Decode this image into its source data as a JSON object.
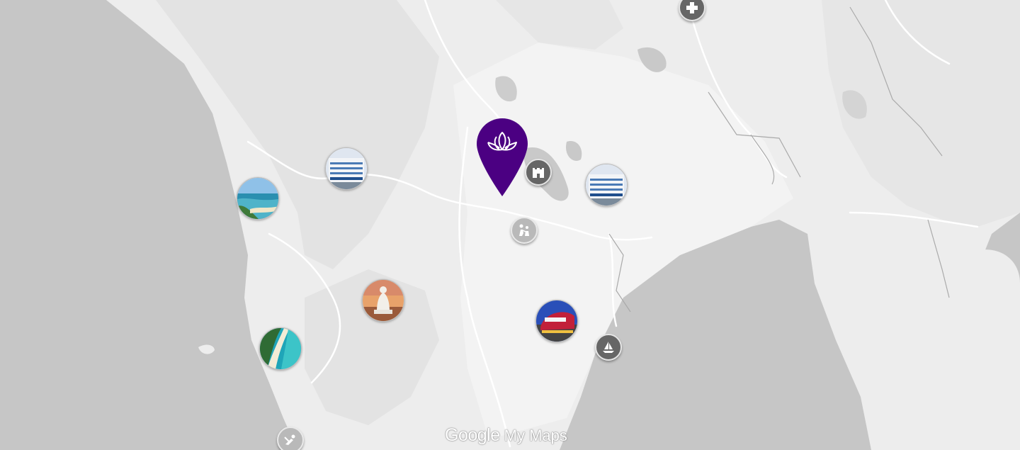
{
  "map": {
    "provider_logo": "Google",
    "product_label": "My Maps",
    "colors": {
      "water": "#c6c6c6",
      "land": "#ededed",
      "land_light": "#f3f3f3",
      "hills": "#e2e2e2",
      "roads": "#ffffff",
      "pin": "#4b0082",
      "poi_dark": "#666666",
      "poi_light": "#b9b9b9"
    },
    "markers": [
      {
        "id": "main-pin",
        "type": "pin",
        "icon": "lotus-icon"
      },
      {
        "id": "school-west",
        "type": "photo",
        "subject": "school-building"
      },
      {
        "id": "school-east",
        "type": "photo",
        "subject": "school-building"
      },
      {
        "id": "beach-north",
        "type": "photo",
        "subject": "beach"
      },
      {
        "id": "beach-south",
        "type": "photo",
        "subject": "beach"
      },
      {
        "id": "big-buddha",
        "type": "photo",
        "subject": "buddha-statue"
      },
      {
        "id": "central-mall",
        "type": "photo",
        "subject": "shopping-mall"
      },
      {
        "id": "hospital",
        "type": "poi",
        "icon": "plus-icon"
      },
      {
        "id": "castle",
        "type": "poi",
        "icon": "castle-icon"
      },
      {
        "id": "family",
        "type": "poi",
        "icon": "family-icon"
      },
      {
        "id": "boat",
        "type": "poi",
        "icon": "sailboat-icon"
      },
      {
        "id": "diving",
        "type": "poi",
        "icon": "diving-icon"
      }
    ]
  }
}
